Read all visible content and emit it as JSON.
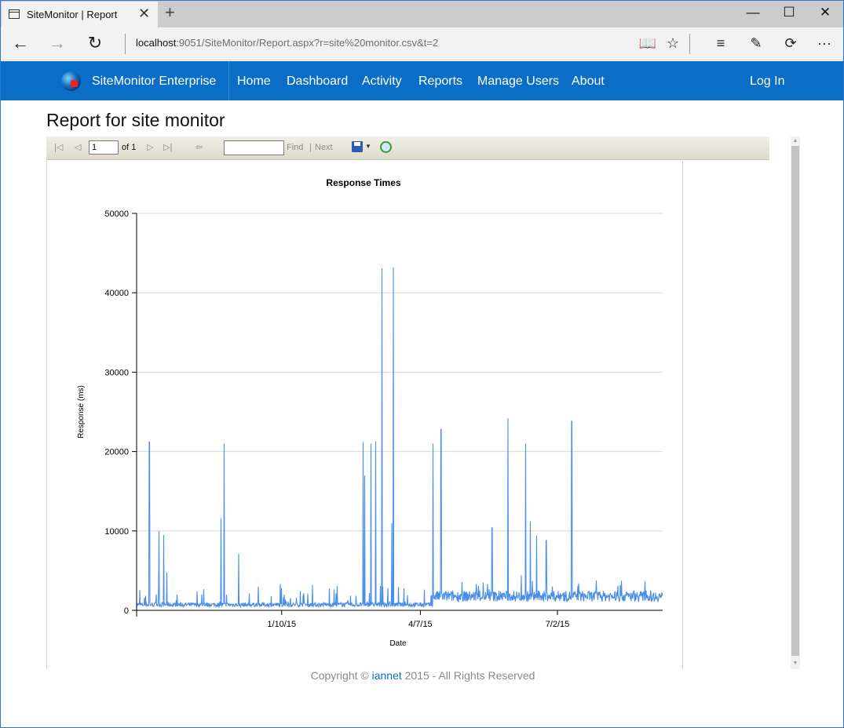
{
  "browser": {
    "tab_title": "SiteMonitor | Report",
    "url_host": "localhost",
    "url_rest": ":9051/SiteMonitor/Report.aspx?r=site%20monitor.csv&t=2"
  },
  "site": {
    "brand": "SiteMonitor Enterprise",
    "nav": [
      "Home",
      "Dashboard",
      "Activity",
      "Reports",
      "Manage Users",
      "About"
    ],
    "login": "Log In"
  },
  "page": {
    "title": "Report for site monitor"
  },
  "report_toolbar": {
    "page_value": "1",
    "of_label": "of 1",
    "find_label": "Find",
    "separator": "|",
    "next_label": "Next"
  },
  "chart_data": {
    "type": "line",
    "title": "Response Times",
    "xlabel": "Date",
    "ylabel": "Response (ms)",
    "ylim": [
      0,
      50000
    ],
    "yticks": [
      "0",
      "10000",
      "20000",
      "30000",
      "40000",
      "50000"
    ],
    "xticks": [
      "1/10/15",
      "4/7/15",
      "7/2/15"
    ],
    "grid": true,
    "color": "#4a8fe7",
    "series": [
      {
        "x_range": [
          "2014-10-11",
          "2015-09-06"
        ],
        "baseline_before": 600,
        "baseline_after": 1500,
        "step_date": "2015-04-15",
        "spikes": [
          {
            "x": "2014-10-19",
            "y": 21200
          },
          {
            "x": "2014-10-25",
            "y": 10000
          },
          {
            "x": "2014-10-28",
            "y": 9500
          },
          {
            "x": "2014-10-30",
            "y": 4800
          },
          {
            "x": "2014-12-03",
            "y": 11600
          },
          {
            "x": "2014-12-05",
            "y": 21000
          },
          {
            "x": "2014-12-14",
            "y": 7100
          },
          {
            "x": "2015-03-02",
            "y": 21200
          },
          {
            "x": "2015-03-03",
            "y": 17000
          },
          {
            "x": "2015-03-07",
            "y": 21000
          },
          {
            "x": "2015-03-10",
            "y": 21300
          },
          {
            "x": "2015-03-14",
            "y": 43100
          },
          {
            "x": "2015-03-21",
            "y": 43200
          },
          {
            "x": "2015-03-20",
            "y": 11000
          },
          {
            "x": "2015-04-15",
            "y": 21000
          },
          {
            "x": "2015-04-20",
            "y": 22800
          },
          {
            "x": "2015-05-22",
            "y": 10400
          },
          {
            "x": "2015-06-01",
            "y": 24200
          },
          {
            "x": "2015-06-12",
            "y": 21000
          },
          {
            "x": "2015-06-15",
            "y": 11200
          },
          {
            "x": "2015-06-19",
            "y": 9400
          },
          {
            "x": "2015-06-25",
            "y": 8800
          },
          {
            "x": "2015-07-11",
            "y": 23800
          }
        ]
      }
    ]
  },
  "footer": {
    "prefix": "Copyright ©",
    "link": "iannet",
    "suffix": "2015 - All Rights Reserved"
  }
}
